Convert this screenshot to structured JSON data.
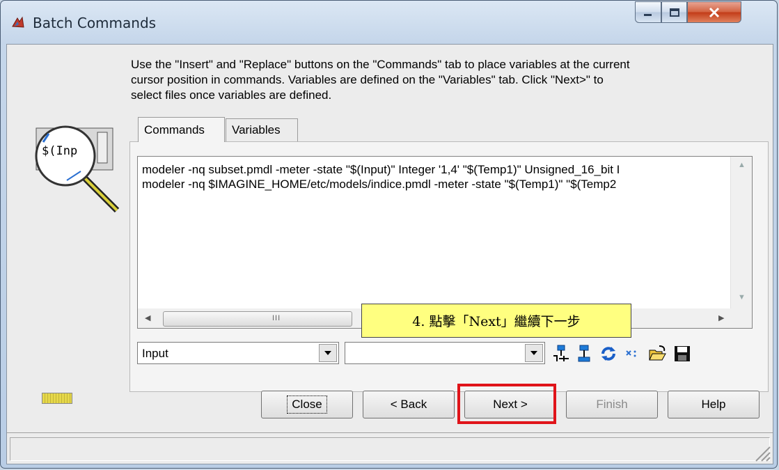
{
  "window": {
    "title": "Batch Commands",
    "icons": {
      "app": "batch-commands-app-icon",
      "minimize": "minimize-icon",
      "maximize": "maximize-icon",
      "close": "close-icon"
    }
  },
  "instruction": "Use the \"Insert\" and \"Replace\" buttons on the \"Commands\" tab to place variables at the current cursor position in commands. Variables are defined on the \"Variables\" tab. Click \"Next>\" to select files once variables are defined.",
  "magnifier_label": "$(Inp",
  "tabs": [
    {
      "label": "Commands",
      "active": true
    },
    {
      "label": "Variables",
      "active": false
    }
  ],
  "commands": [
    "modeler -nq subset.pmdl -meter -state \"$(Input)\" Integer '1,4' \"$(Temp1)\" Unsigned_16_bit I",
    "modeler -nq $IMAGINE_HOME/etc/models/indice.pmdl -meter -state \"$(Temp1)\" \"$(Temp2"
  ],
  "scrollbar_grip": "III",
  "variable_select": {
    "value": "Input"
  },
  "replace_select": {
    "value": ""
  },
  "toolbar_icons": [
    "insert-variable-icon",
    "replace-variable-icon",
    "refresh-icon",
    "clear-variable-icon",
    "open-folder-icon",
    "save-disk-icon"
  ],
  "buttons": {
    "close": "Close",
    "back": "< Back",
    "next": "Next >",
    "finish": "Finish",
    "help": "Help"
  },
  "callout": "4. 點擊「Next」繼續下一步",
  "colors": {
    "highlight": "#e0141a",
    "callout_bg": "#ffff80"
  }
}
